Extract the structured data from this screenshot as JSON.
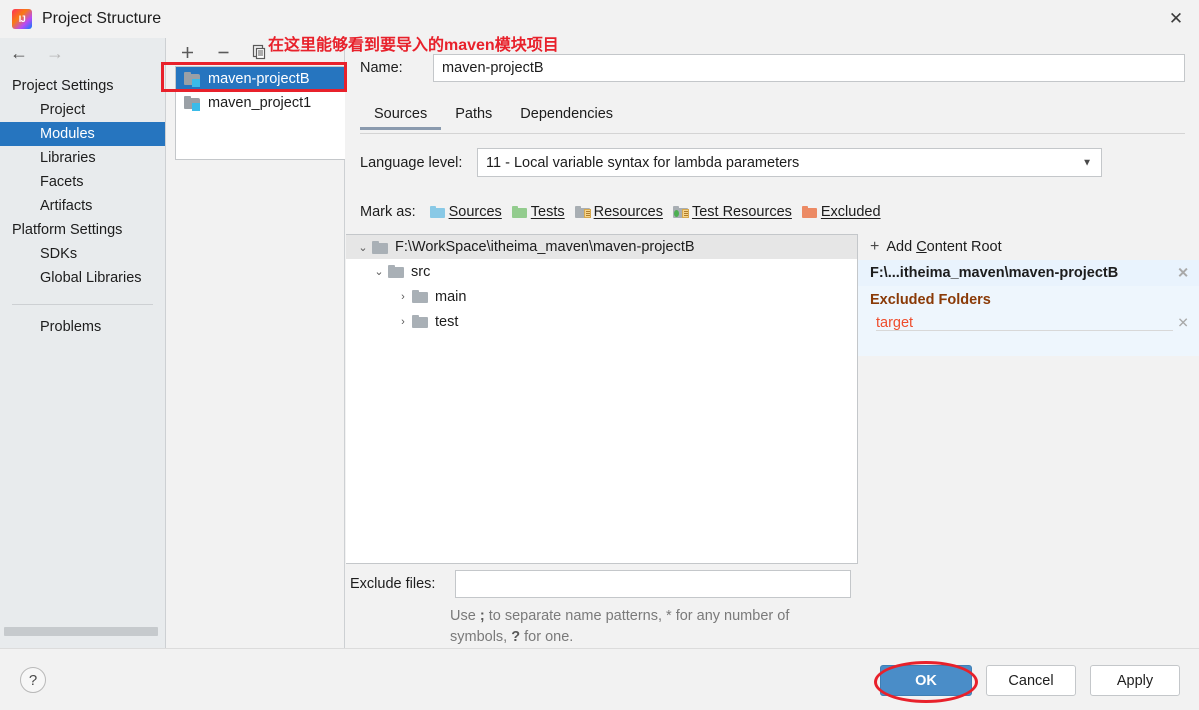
{
  "window": {
    "title": "Project Structure",
    "logo_icon": "intellij-idea-logo",
    "close_icon": "✕"
  },
  "nav": {
    "back_icon": "←",
    "forward_icon": "→"
  },
  "sidebar": {
    "groups": [
      {
        "label": "Project Settings"
      },
      {
        "label": "Platform Settings"
      }
    ],
    "project_settings_items": [
      {
        "label": "Project",
        "selected": false
      },
      {
        "label": "Modules",
        "selected": true
      },
      {
        "label": "Libraries",
        "selected": false
      },
      {
        "label": "Facets",
        "selected": false
      },
      {
        "label": "Artifacts",
        "selected": false
      }
    ],
    "platform_settings_items": [
      {
        "label": "SDKs",
        "selected": false
      },
      {
        "label": "Global Libraries",
        "selected": false
      }
    ],
    "problems_label": "Problems"
  },
  "modules_toolbar": {
    "add_icon": "+",
    "remove_icon": "−",
    "copy_icon": "copy-icon"
  },
  "modules_list": [
    {
      "name": "maven-projectB",
      "selected": true
    },
    {
      "name": "maven_project1",
      "selected": false
    }
  ],
  "name_field": {
    "label": "Name:",
    "value": "maven-projectB",
    "placeholder": ""
  },
  "tabs": [
    {
      "label": "Sources",
      "active": true
    },
    {
      "label": "Paths",
      "active": false
    },
    {
      "label": "Dependencies",
      "active": false
    }
  ],
  "language_level": {
    "label": "Language level:",
    "value": "11 - Local variable syntax for lambda parameters",
    "caret_icon": "▼"
  },
  "mark_as": {
    "label": "Mark as:",
    "items": [
      {
        "label": "Sources",
        "mnemonic": "S",
        "rest": "ources",
        "color": "#89c9e6"
      },
      {
        "label": "Tests",
        "mnemonic": "T",
        "rest": "ests",
        "color": "#93cc8e"
      },
      {
        "label": "Resources",
        "mnemonic": "R",
        "rest": "esources",
        "color": "#a8aeb3"
      },
      {
        "label": "Test Resources",
        "mnemonic": "",
        "rest": "Test Resources",
        "color": "#a8aeb3"
      },
      {
        "label": "Excluded",
        "mnemonic": "E",
        "rest": "xcluded",
        "color": "#ec8a64"
      }
    ]
  },
  "tree": {
    "root": {
      "label": "F:\\WorkSpace\\itheima_maven\\maven-projectB",
      "expanded": true
    },
    "nodes": [
      {
        "label": "src",
        "depth": 1,
        "expanded": true,
        "twisty": "⌄"
      },
      {
        "label": "main",
        "depth": 2,
        "expanded": false,
        "twisty": "›"
      },
      {
        "label": "test",
        "depth": 2,
        "expanded": false,
        "twisty": "›"
      }
    ]
  },
  "content_root": {
    "add_label_prefix": "Add ",
    "add_mnemonic": "C",
    "add_label_suffix": "ontent Root",
    "plus_icon": "+",
    "path": "F:\\...itheima_maven\\maven-projectB",
    "path_remove_icon": "✕",
    "excluded_folders_label": "Excluded Folders",
    "excluded_folders_color": "#8a3a07",
    "excluded_items": [
      {
        "name": "target",
        "color": "#ee4d2d",
        "remove_icon": "✕"
      }
    ]
  },
  "exclude_files": {
    "label": "Exclude files:",
    "value": "",
    "placeholder": "",
    "hint_part1": "Use ",
    "hint_semicolon": ";",
    "hint_part2": " to separate name patterns, * for any number of symbols, ",
    "hint_question": "?",
    "hint_part3": " for one."
  },
  "footer": {
    "help_icon": "?",
    "ok_label": "OK",
    "cancel_label": "Cancel",
    "apply_label": "Apply"
  },
  "annotations": {
    "color": "#e8212b",
    "callout_text": "在这里能够看到要导入的maven模块项目",
    "highlight_box_target": "maven-projectB",
    "highlight_ellipse_target": "OK"
  }
}
